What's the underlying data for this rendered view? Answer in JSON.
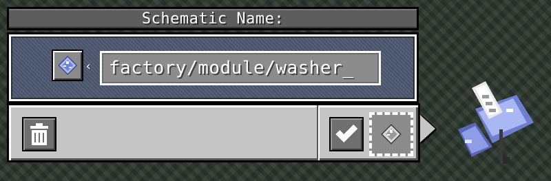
{
  "title": "Schematic Name:",
  "name_input": {
    "value": "factory/module/washer_"
  },
  "slot_arrow": "‹",
  "icons": {
    "schematic_slot": "empty-schematic-icon",
    "trash": "trash-icon",
    "confirm": "checkmark-icon",
    "output": "empty-schematic-icon",
    "held_item": "written-schematic-icon"
  },
  "colors": {
    "title_bar": "#5d5d5d",
    "input_panel": "#4d576f",
    "bottom_panel": "#c6c6c6",
    "text": "#ffffff"
  }
}
